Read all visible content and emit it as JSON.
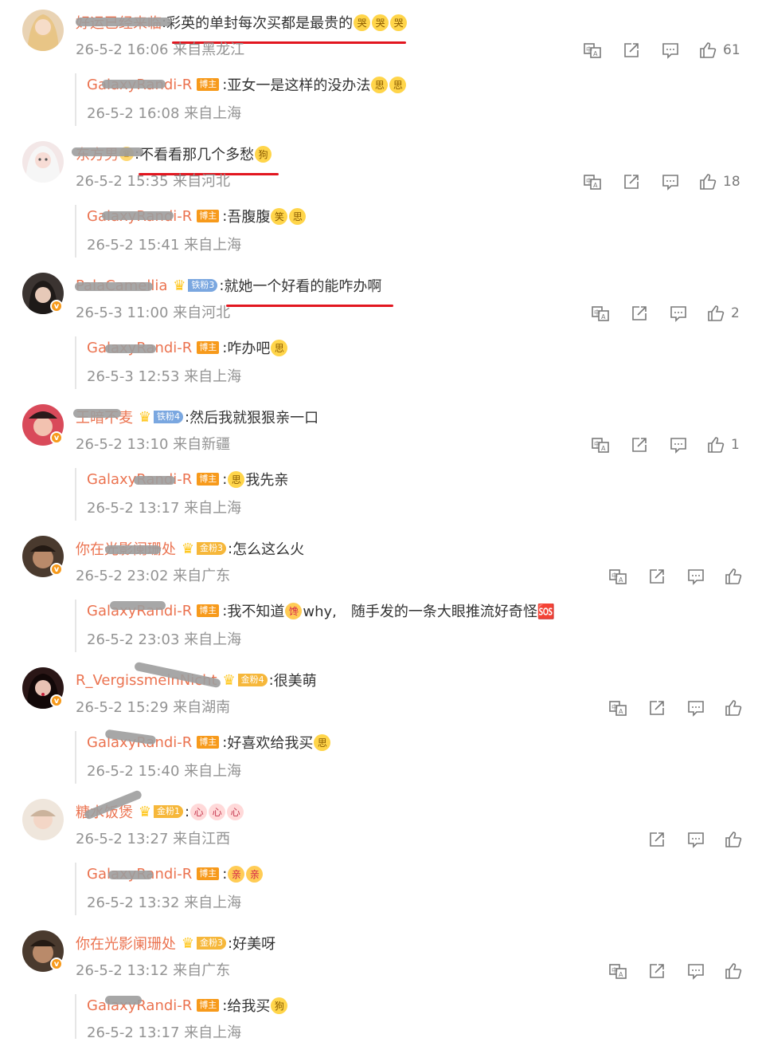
{
  "comments": [
    {
      "username": "好运已经来临",
      "badge": "",
      "text": "彩英的单封每次买都是最贵的",
      "emojis": [
        "哭",
        "哭",
        "哭"
      ],
      "date": "26-5-2 16:06 来自黑龙江",
      "like_count": "61",
      "reply": {
        "username": "GalaxyRandi-R",
        "tag": "博主",
        "text": "亚女一是这样的没办法",
        "emojis": [
          "思",
          "思"
        ],
        "date": "26-5-2 16:08 来自上海"
      }
    },
    {
      "username": "东方男",
      "badge": "",
      "text": "不看看那几个多愁",
      "emojis": [
        "狗"
      ],
      "date": "26-5-2 15:35 来自河北",
      "like_count": "18",
      "reply": {
        "username": "GalaxyRandi-R",
        "tag": "博主",
        "text": "吾腹腹",
        "emojis": [
          "笑",
          "思"
        ],
        "date": "26-5-2 15:41 来自上海"
      }
    },
    {
      "username": "PalaCamellia",
      "badge": "铁粉3",
      "text": "就她一个好看的能咋办啊",
      "emojis": [],
      "date": "26-5-3 11:00 来自河北",
      "like_count": "2",
      "reply": {
        "username": "GalaxyRandi-R",
        "tag": "博主",
        "text": "咋办吧",
        "emojis": [
          "思"
        ],
        "date": "26-5-3 12:53 来自上海"
      }
    },
    {
      "username": "王暗不麦",
      "badge": "铁粉4",
      "text": "然后我就狠狠亲一口",
      "emojis": [],
      "date": "26-5-2 13:10 来自新疆",
      "like_count": "1",
      "reply": {
        "username": "GalaxyRandi-R",
        "tag": "博主",
        "text": "我先亲",
        "emojis_before": [
          "思"
        ],
        "emojis": [],
        "date": "26-5-2 13:17 来自上海"
      }
    },
    {
      "username": "你在光影阑珊处",
      "badge": "金粉3",
      "text": "怎么这么火",
      "emojis": [],
      "date": "26-5-2 23:02 来自广东",
      "like_count": "",
      "reply": {
        "username": "GalaxyRandi-R",
        "tag": "博主",
        "text": "我不知道",
        "emojis": [
          "馋"
        ],
        "text2": " why,　随手发的一条大眼推流好奇怪🆘",
        "date": "26-5-2 23:03 来自上海"
      }
    },
    {
      "username": "R_VergissmeinNicht",
      "badge": "金粉4",
      "text": "很美萌",
      "emojis": [],
      "date": "26-5-2 15:29 来自湖南",
      "like_count": "",
      "reply": {
        "username": "GalaxyRandi-R",
        "tag": "博主",
        "text": "好喜欢给我买",
        "emojis": [
          "思"
        ],
        "date": "26-5-2 15:40 来自上海"
      }
    },
    {
      "username": "糖水饭煲",
      "badge": "金粉1",
      "text": "",
      "emojis": [
        "心",
        "心",
        "心"
      ],
      "date": "26-5-2 13:27 来自江西",
      "like_count": "",
      "reply": {
        "username": "GalaxyRandi-R",
        "tag": "博主",
        "text": "",
        "emojis": [
          "亲",
          "亲"
        ],
        "date": "26-5-2 13:32 来自上海"
      }
    },
    {
      "username": "你在光影阑珊处",
      "badge": "金粉3",
      "text": "好美呀",
      "emojis": [],
      "date": "26-5-2 13:12 来自广东",
      "like_count": "",
      "reply": {
        "username": "GalaxyRandi-R",
        "tag": "博主",
        "text": "给我买",
        "emojis": [
          "狗"
        ],
        "date": "26-5-2 13:17 来自上海"
      }
    }
  ],
  "colors": {
    "username": "#eb7350",
    "meta": "#939393",
    "highlight": "#e2161f",
    "bozhu_tag": "#f79a1b"
  },
  "icons": [
    "translate-icon",
    "share-icon",
    "comment-icon",
    "like-icon"
  ]
}
